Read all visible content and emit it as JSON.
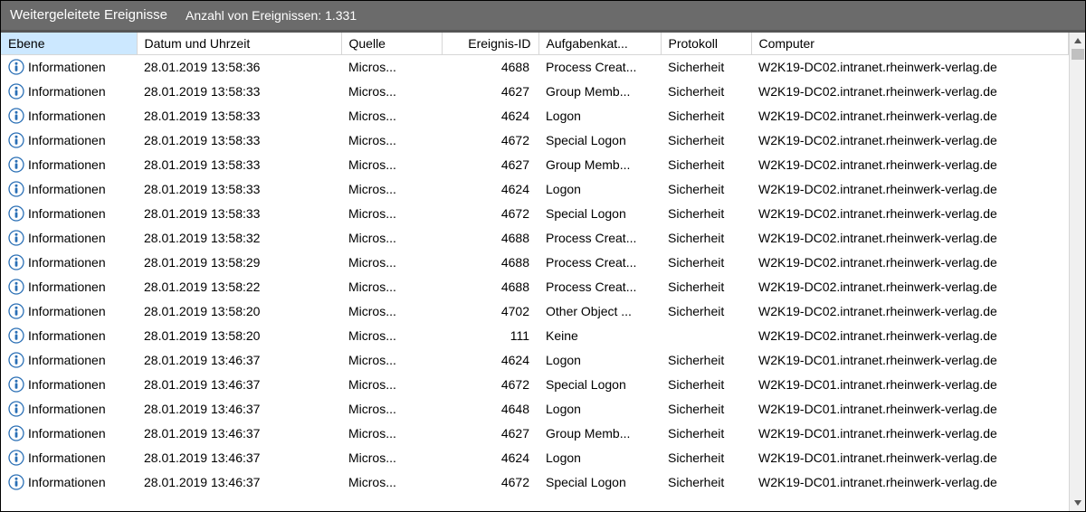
{
  "header": {
    "title": "Weitergeleitete Ereignisse",
    "count_label": "Anzahl von Ereignissen: 1.331"
  },
  "columns": {
    "level": "Ebene",
    "datetime": "Datum und Uhrzeit",
    "source": "Quelle",
    "event_id": "Ereignis-ID",
    "task_cat": "Aufgabenkat...",
    "protocol": "Protokoll",
    "computer": "Computer"
  },
  "rows": [
    {
      "level": "Informationen",
      "dt": "28.01.2019 13:58:36",
      "src": "Micros...",
      "id": "4688",
      "task": "Process Creat...",
      "proto": "Sicherheit",
      "comp": "W2K19-DC02.intranet.rheinwerk-verlag.de"
    },
    {
      "level": "Informationen",
      "dt": "28.01.2019 13:58:33",
      "src": "Micros...",
      "id": "4627",
      "task": "Group Memb...",
      "proto": "Sicherheit",
      "comp": "W2K19-DC02.intranet.rheinwerk-verlag.de"
    },
    {
      "level": "Informationen",
      "dt": "28.01.2019 13:58:33",
      "src": "Micros...",
      "id": "4624",
      "task": "Logon",
      "proto": "Sicherheit",
      "comp": "W2K19-DC02.intranet.rheinwerk-verlag.de"
    },
    {
      "level": "Informationen",
      "dt": "28.01.2019 13:58:33",
      "src": "Micros...",
      "id": "4672",
      "task": "Special Logon",
      "proto": "Sicherheit",
      "comp": "W2K19-DC02.intranet.rheinwerk-verlag.de"
    },
    {
      "level": "Informationen",
      "dt": "28.01.2019 13:58:33",
      "src": "Micros...",
      "id": "4627",
      "task": "Group Memb...",
      "proto": "Sicherheit",
      "comp": "W2K19-DC02.intranet.rheinwerk-verlag.de"
    },
    {
      "level": "Informationen",
      "dt": "28.01.2019 13:58:33",
      "src": "Micros...",
      "id": "4624",
      "task": "Logon",
      "proto": "Sicherheit",
      "comp": "W2K19-DC02.intranet.rheinwerk-verlag.de"
    },
    {
      "level": "Informationen",
      "dt": "28.01.2019 13:58:33",
      "src": "Micros...",
      "id": "4672",
      "task": "Special Logon",
      "proto": "Sicherheit",
      "comp": "W2K19-DC02.intranet.rheinwerk-verlag.de"
    },
    {
      "level": "Informationen",
      "dt": "28.01.2019 13:58:32",
      "src": "Micros...",
      "id": "4688",
      "task": "Process Creat...",
      "proto": "Sicherheit",
      "comp": "W2K19-DC02.intranet.rheinwerk-verlag.de"
    },
    {
      "level": "Informationen",
      "dt": "28.01.2019 13:58:29",
      "src": "Micros...",
      "id": "4688",
      "task": "Process Creat...",
      "proto": "Sicherheit",
      "comp": "W2K19-DC02.intranet.rheinwerk-verlag.de"
    },
    {
      "level": "Informationen",
      "dt": "28.01.2019 13:58:22",
      "src": "Micros...",
      "id": "4688",
      "task": "Process Creat...",
      "proto": "Sicherheit",
      "comp": "W2K19-DC02.intranet.rheinwerk-verlag.de"
    },
    {
      "level": "Informationen",
      "dt": "28.01.2019 13:58:20",
      "src": "Micros...",
      "id": "4702",
      "task": "Other Object ...",
      "proto": "Sicherheit",
      "comp": "W2K19-DC02.intranet.rheinwerk-verlag.de"
    },
    {
      "level": "Informationen",
      "dt": "28.01.2019 13:58:20",
      "src": "Micros...",
      "id": "111",
      "task": "Keine",
      "proto": "",
      "comp": "W2K19-DC02.intranet.rheinwerk-verlag.de"
    },
    {
      "level": "Informationen",
      "dt": "28.01.2019 13:46:37",
      "src": "Micros...",
      "id": "4624",
      "task": "Logon",
      "proto": "Sicherheit",
      "comp": "W2K19-DC01.intranet.rheinwerk-verlag.de"
    },
    {
      "level": "Informationen",
      "dt": "28.01.2019 13:46:37",
      "src": "Micros...",
      "id": "4672",
      "task": "Special Logon",
      "proto": "Sicherheit",
      "comp": "W2K19-DC01.intranet.rheinwerk-verlag.de"
    },
    {
      "level": "Informationen",
      "dt": "28.01.2019 13:46:37",
      "src": "Micros...",
      "id": "4648",
      "task": "Logon",
      "proto": "Sicherheit",
      "comp": "W2K19-DC01.intranet.rheinwerk-verlag.de"
    },
    {
      "level": "Informationen",
      "dt": "28.01.2019 13:46:37",
      "src": "Micros...",
      "id": "4627",
      "task": "Group Memb...",
      "proto": "Sicherheit",
      "comp": "W2K19-DC01.intranet.rheinwerk-verlag.de"
    },
    {
      "level": "Informationen",
      "dt": "28.01.2019 13:46:37",
      "src": "Micros...",
      "id": "4624",
      "task": "Logon",
      "proto": "Sicherheit",
      "comp": "W2K19-DC01.intranet.rheinwerk-verlag.de"
    },
    {
      "level": "Informationen",
      "dt": "28.01.2019 13:46:37",
      "src": "Micros...",
      "id": "4672",
      "task": "Special Logon",
      "proto": "Sicherheit",
      "comp": "W2K19-DC01.intranet.rheinwerk-verlag.de"
    }
  ]
}
